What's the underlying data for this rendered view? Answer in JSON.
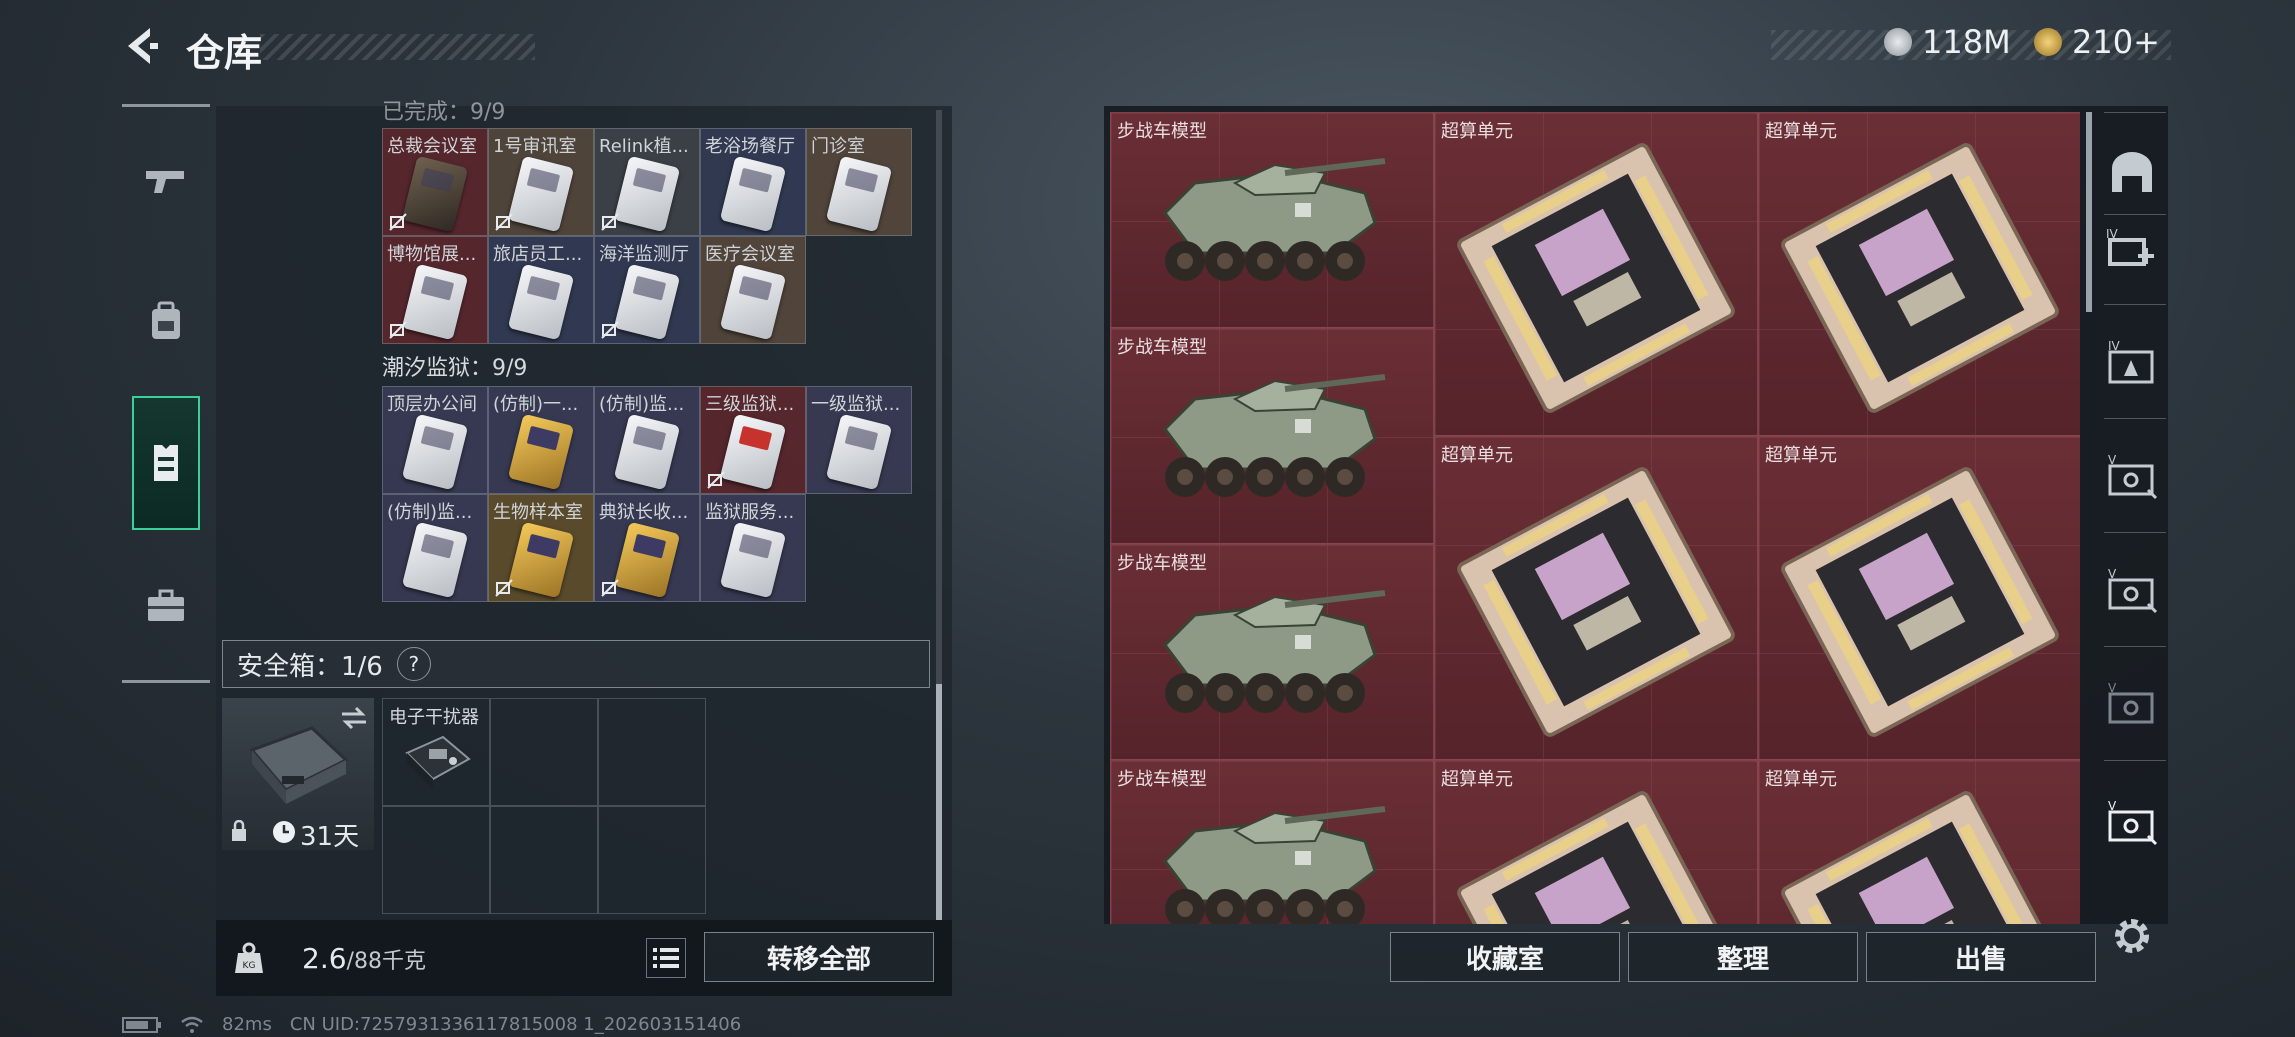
{
  "header": {
    "title": "仓库",
    "currency1": "118M",
    "currency2": "210+"
  },
  "left_nav": {
    "items": [
      "gun-icon",
      "backpack-icon",
      "vest-icon",
      "briefcase-icon"
    ],
    "active_index": 2
  },
  "inventory": {
    "section_top_partial": "已完成：9/9",
    "group1_row1": [
      {
        "label": "总裁会议室",
        "card": "dark",
        "bg": "red",
        "locked": true
      },
      {
        "label": "1号审讯室",
        "card": "white",
        "bg": "brown",
        "locked": true
      },
      {
        "label": "Relink植...",
        "card": "white",
        "bg": "gray",
        "locked": true
      },
      {
        "label": "老浴场餐厅",
        "card": "white",
        "bg": "navy",
        "locked": false
      },
      {
        "label": "门诊室",
        "card": "white",
        "bg": "brown",
        "locked": false
      }
    ],
    "group1_row2": [
      {
        "label": "博物馆展...",
        "card": "white",
        "bg": "red",
        "locked": true
      },
      {
        "label": "旅店员工...",
        "card": "white",
        "bg": "navy",
        "locked": false
      },
      {
        "label": "海洋监测厅",
        "card": "white",
        "bg": "navy",
        "locked": true
      },
      {
        "label": "医疗会议室",
        "card": "white",
        "bg": "brown",
        "locked": false
      }
    ],
    "section2_label": "潮汐监狱：9/9",
    "group2_row1": [
      {
        "label": "顶层办公间",
        "card": "white",
        "bg": "purple",
        "locked": false
      },
      {
        "label": "(仿制)一...",
        "card": "gold",
        "bg": "purple",
        "locked": false
      },
      {
        "label": "(仿制)监...",
        "card": "white",
        "bg": "purple",
        "locked": false
      },
      {
        "label": "三级监狱...",
        "card": "red",
        "bg": "red",
        "locked": true
      },
      {
        "label": "一级监狱...",
        "card": "white",
        "bg": "purple",
        "locked": false
      }
    ],
    "group2_row2": [
      {
        "label": "(仿制)监...",
        "card": "white",
        "bg": "purple",
        "locked": false
      },
      {
        "label": "生物样本室",
        "card": "gold",
        "bg": "gold",
        "locked": true
      },
      {
        "label": "典狱长收...",
        "card": "gold",
        "bg": "purple",
        "locked": true
      },
      {
        "label": "监狱服务...",
        "card": "white",
        "bg": "purple",
        "locked": false
      }
    ]
  },
  "safebox": {
    "label": "安全箱：1/6",
    "help": "?",
    "duration": "31天",
    "item_label": "电子干扰器"
  },
  "bottom_left": {
    "weight_current": "2.6",
    "weight_max": "/88千克",
    "transfer_all": "转移全部"
  },
  "stash": {
    "vehicle_label": "步战车模型",
    "cpu_label": "超算单元"
  },
  "bottom_right": {
    "collection": "收藏室",
    "organize": "整理",
    "sell": "出售"
  },
  "status": {
    "ping": "82ms",
    "uid": "CN UID:7257931336117815008 1_202603151406"
  }
}
